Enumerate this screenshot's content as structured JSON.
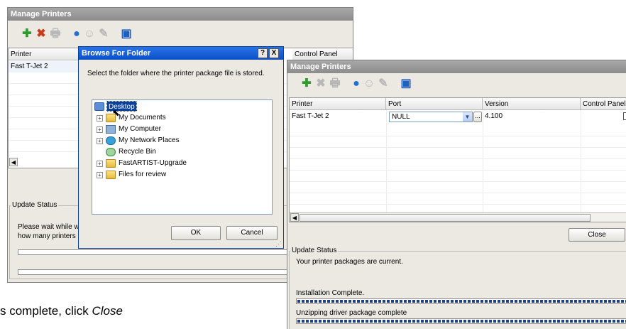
{
  "bg_window": {
    "title": "Manage Printers",
    "columns": [
      "Printer",
      "Control Panel"
    ],
    "row_printer": "Fast T-Jet 2",
    "group_label": "Update Status",
    "status_lines": [
      "Please wait while w",
      "how many printers"
    ]
  },
  "browse": {
    "title": "Browse For Folder",
    "help_label": "?",
    "close_label": "X",
    "prompt": "Select the folder where the printer package file is stored.",
    "tree": [
      {
        "label": "Desktop",
        "icon": "desktop-icon"
      },
      {
        "label": "My Documents",
        "icon": "folder-icon"
      },
      {
        "label": "My Computer",
        "icon": "computer-icon"
      },
      {
        "label": "My Network Places",
        "icon": "network-icon"
      },
      {
        "label": "Recycle Bin",
        "icon": "recycle-bin-icon"
      },
      {
        "label": "FastARTIST-Upgrade",
        "icon": "folder-icon"
      },
      {
        "label": "Files for review",
        "icon": "folder-icon"
      }
    ],
    "ok_label": "OK",
    "cancel_label": "Cancel"
  },
  "fg_window": {
    "title": "Manage Printers",
    "columns": [
      "Printer",
      "Port",
      "Version",
      "Control Panel"
    ],
    "row": {
      "printer": "Fast T-Jet 2",
      "port": "NULL",
      "version": "4.100"
    },
    "ellipsis_label": "...",
    "close_label": "Close",
    "group_label": "Update Status",
    "status_text": "Your printer packages are current.",
    "progress_1_label": "Installation Complete.",
    "progress_2_label": "Unzipping driver package complete",
    "progress_1_value": 1.0,
    "progress_2_value": 1.0
  },
  "caption": {
    "text_prefix": "s complete, click ",
    "text_emphasis": "Close"
  },
  "colors": {
    "accent_blue": "#1f3f8f",
    "title_gray": "#8c8c8c",
    "xp_title": "#0a5fd8",
    "add_green": "#2f9b2f",
    "delete_red": "#c83c1e"
  }
}
